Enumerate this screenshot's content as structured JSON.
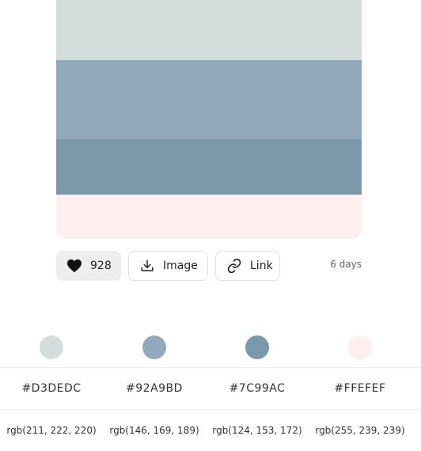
{
  "palette": {
    "swatches": [
      {
        "hex": "#D3DEDC",
        "height": 88
      },
      {
        "hex": "#92A9BD",
        "height": 100
      },
      {
        "hex": "#7C99AC",
        "height": 70
      },
      {
        "hex": "#FFEFEF",
        "height": 56
      }
    ]
  },
  "actions": {
    "likes": "928",
    "image_label": "Image",
    "link_label": "Link",
    "age": "6 days"
  },
  "colors": [
    {
      "hex": "#D3DEDC",
      "rgb": "rgb(211, 222, 220)"
    },
    {
      "hex": "#92A9BD",
      "rgb": "rgb(146, 169, 189)"
    },
    {
      "hex": "#7C99AC",
      "rgb": "rgb(124, 153, 172)"
    },
    {
      "hex": "#FFEFEF",
      "rgb": "rgb(255, 239, 239)"
    }
  ]
}
